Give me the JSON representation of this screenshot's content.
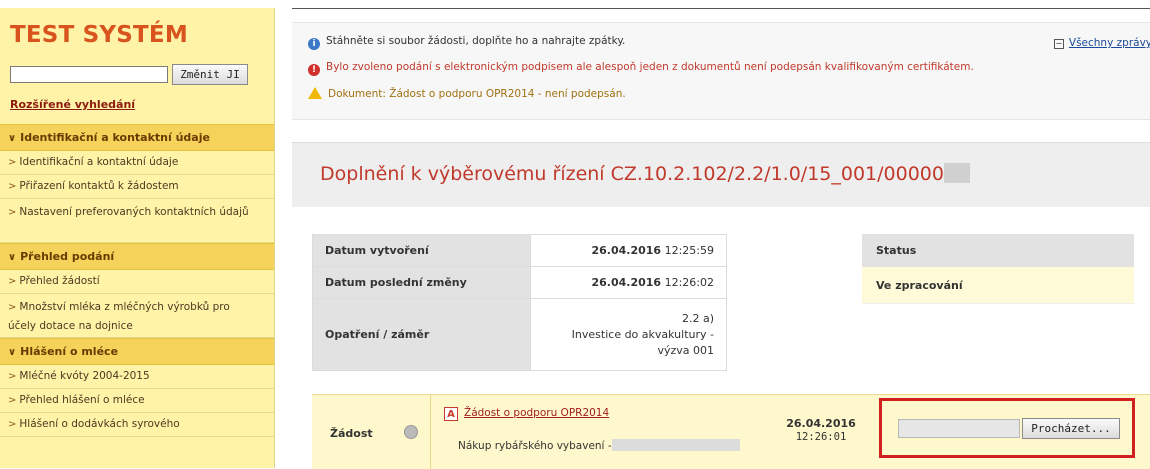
{
  "sidebar": {
    "logo": "TEST SYSTÉM",
    "search": {
      "value": "",
      "button": "Změnit JI"
    },
    "advanced_search": "Rozšířené vyhledání",
    "sections": [
      {
        "label": "Identifikační a kontaktní údaje",
        "items": [
          "Identifikační a kontaktní údaje",
          "Přiřazení kontaktů k žádostem",
          "Nastavení preferovaných kontaktních údajů"
        ]
      },
      {
        "label": "Přehled podání",
        "items": [
          "Přehled žádostí",
          "Množství mléka z mléčných výrobků pro účely dotace na dojnice"
        ]
      },
      {
        "label": "Hlášení o mléce",
        "items": [
          "Mléčné kvóty 2004-2015",
          "Přehled hlášení o mléce",
          "Hlášení o dodávkách syrového"
        ]
      }
    ]
  },
  "messages": {
    "info": "Stáhněte si soubor žádosti, doplňte ho a nahrajte zpátky.",
    "error": "Bylo zvoleno podání s elektronickým podpisem ale alespoň jeden z dokumentů není podepsán kvalifikovaným certifikátem.",
    "warning": "Dokument: Žádost o podporu OPR2014 - není podepsán.",
    "all_link": "Všechny zprávy"
  },
  "page_title": "Doplnění k výběrovému řízení CZ.10.2.102/2.2/1.0/15_001/00000",
  "details": {
    "created_label": "Datum vytvoření",
    "created_date": "26.04.2016",
    "created_time": "12:25:59",
    "changed_label": "Datum poslední změny",
    "changed_date": "26.04.2016",
    "changed_time": "12:26:02",
    "measure_label": "Opatření / záměr",
    "measure_code": "2.2 a)",
    "measure_line2": "Investice do akvakultury -",
    "measure_line3": "výzva 001"
  },
  "status": {
    "label": "Status",
    "value": "Ve zpracování"
  },
  "request": {
    "label": "Žádost",
    "doc_link": "Žádost o podporu OPR2014",
    "description": "Nákup rybářského vybavení -",
    "date": "26.04.2016",
    "time": "12:26:01",
    "browse_button": "Procházet..."
  },
  "colors": {
    "accent": "#c0392b",
    "sidebar": "#fff3a8",
    "section": "#f5d25a",
    "highlight_frame": "#d02020"
  }
}
